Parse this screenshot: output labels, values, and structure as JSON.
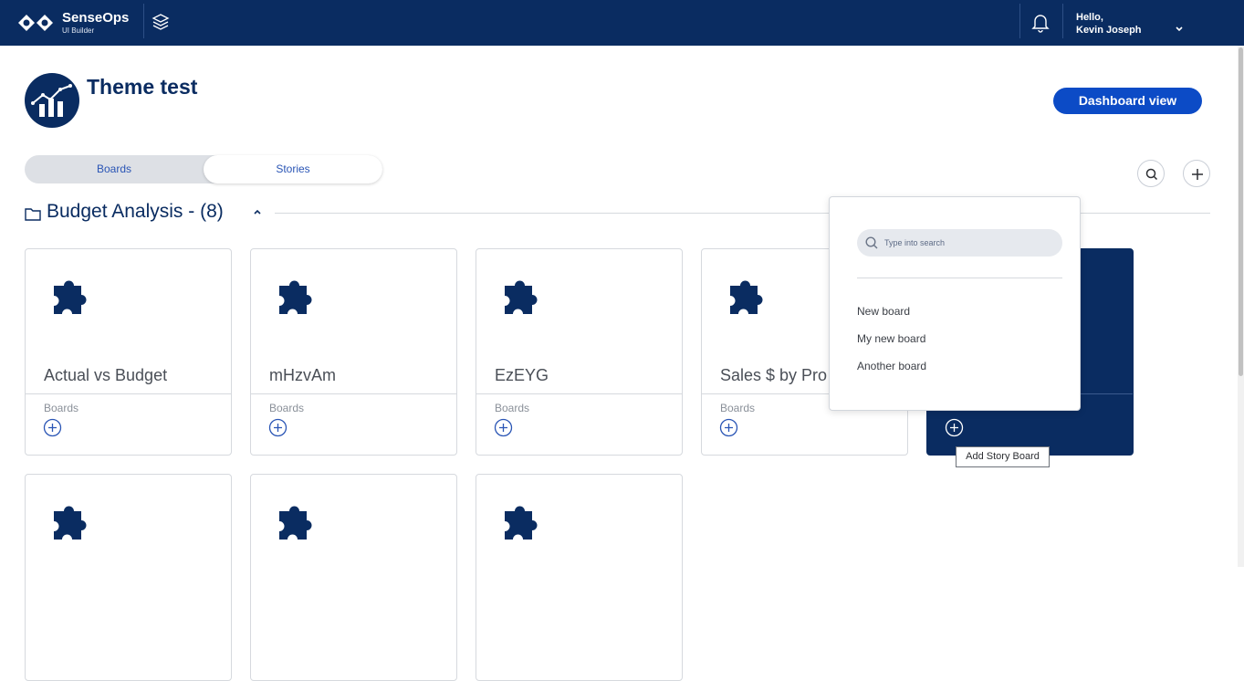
{
  "header": {
    "brand_name": "SenseOps",
    "brand_sub": "UI Builder",
    "greeting_line1": "Hello,",
    "greeting_line2": "Kevin Joseph"
  },
  "page": {
    "title": "Theme test",
    "dashboard_button": "Dashboard view"
  },
  "tabs": [
    {
      "label": "Boards",
      "active": true
    },
    {
      "label": "Stories",
      "active": false
    }
  ],
  "section": {
    "title": "Budget Analysis - (8)"
  },
  "cards": [
    {
      "title": "Actual vs Budget",
      "sub": "Boards"
    },
    {
      "title": "mHzvAm",
      "sub": "Boards"
    },
    {
      "title": "EzEYG",
      "sub": "Boards"
    },
    {
      "title": "Sales $ by Pro",
      "sub": "Boards"
    },
    {
      "title": "",
      "sub": ""
    }
  ],
  "tooltip": "Add Story Board",
  "popup": {
    "search_placeholder": "Type into search",
    "items": [
      "New board",
      "My new board",
      "Another board"
    ]
  },
  "colors": {
    "navy": "#0a2c61",
    "accent_blue": "#0c4bc6"
  }
}
